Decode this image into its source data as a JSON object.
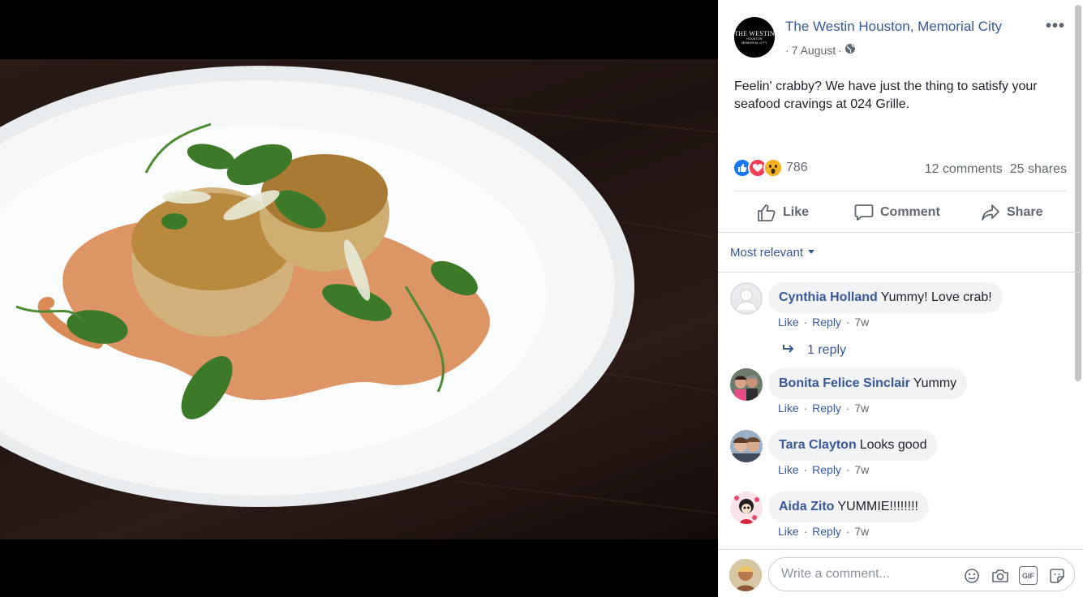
{
  "post": {
    "page_name": "The Westin Houston, Memorial City",
    "page_logo": {
      "brand": "THE WESTIN",
      "city": "HOUSTON",
      "sub": "MEMORIAL CITY"
    },
    "date": "7 August",
    "privacy_icon": "globe-icon",
    "more_label": "•••",
    "text": "Feelin' crabby? We have just the thing to satisfy your seafood cravings at 024 Grille.",
    "reactions_count": "786",
    "comments_count": "12 comments",
    "shares_count": "25 shares"
  },
  "actions": {
    "like": "Like",
    "comment": "Comment",
    "share": "Share"
  },
  "sort_label": "Most relevant",
  "comments": [
    {
      "name": "Cynthia Holland",
      "text": "Yummy! Love crab!",
      "like": "Like",
      "reply": "Reply",
      "time": "7w"
    },
    {
      "name": "Bonita Felice Sinclair",
      "text": "Yummy",
      "like": "Like",
      "reply": "Reply",
      "time": "7w"
    },
    {
      "name": "Tara Clayton",
      "text": "Looks good",
      "like": "Like",
      "reply": "Reply",
      "time": "7w"
    },
    {
      "name": "Aida Zito",
      "text": "YUMMIE!!!!!!!!",
      "like": "Like",
      "reply": "Reply",
      "time": "7w"
    }
  ],
  "replies_link": "1 reply",
  "composer": {
    "placeholder": "Write a comment...",
    "tools": [
      "emoji-icon",
      "camera-icon",
      "gif-icon",
      "sticker-icon"
    ],
    "gif_label": "GIF"
  },
  "colors": {
    "link": "#385898",
    "muted": "#606770",
    "like_blue": "#1877f2",
    "love_red": "#f33e58",
    "wow_yellow": "#f7b125"
  }
}
